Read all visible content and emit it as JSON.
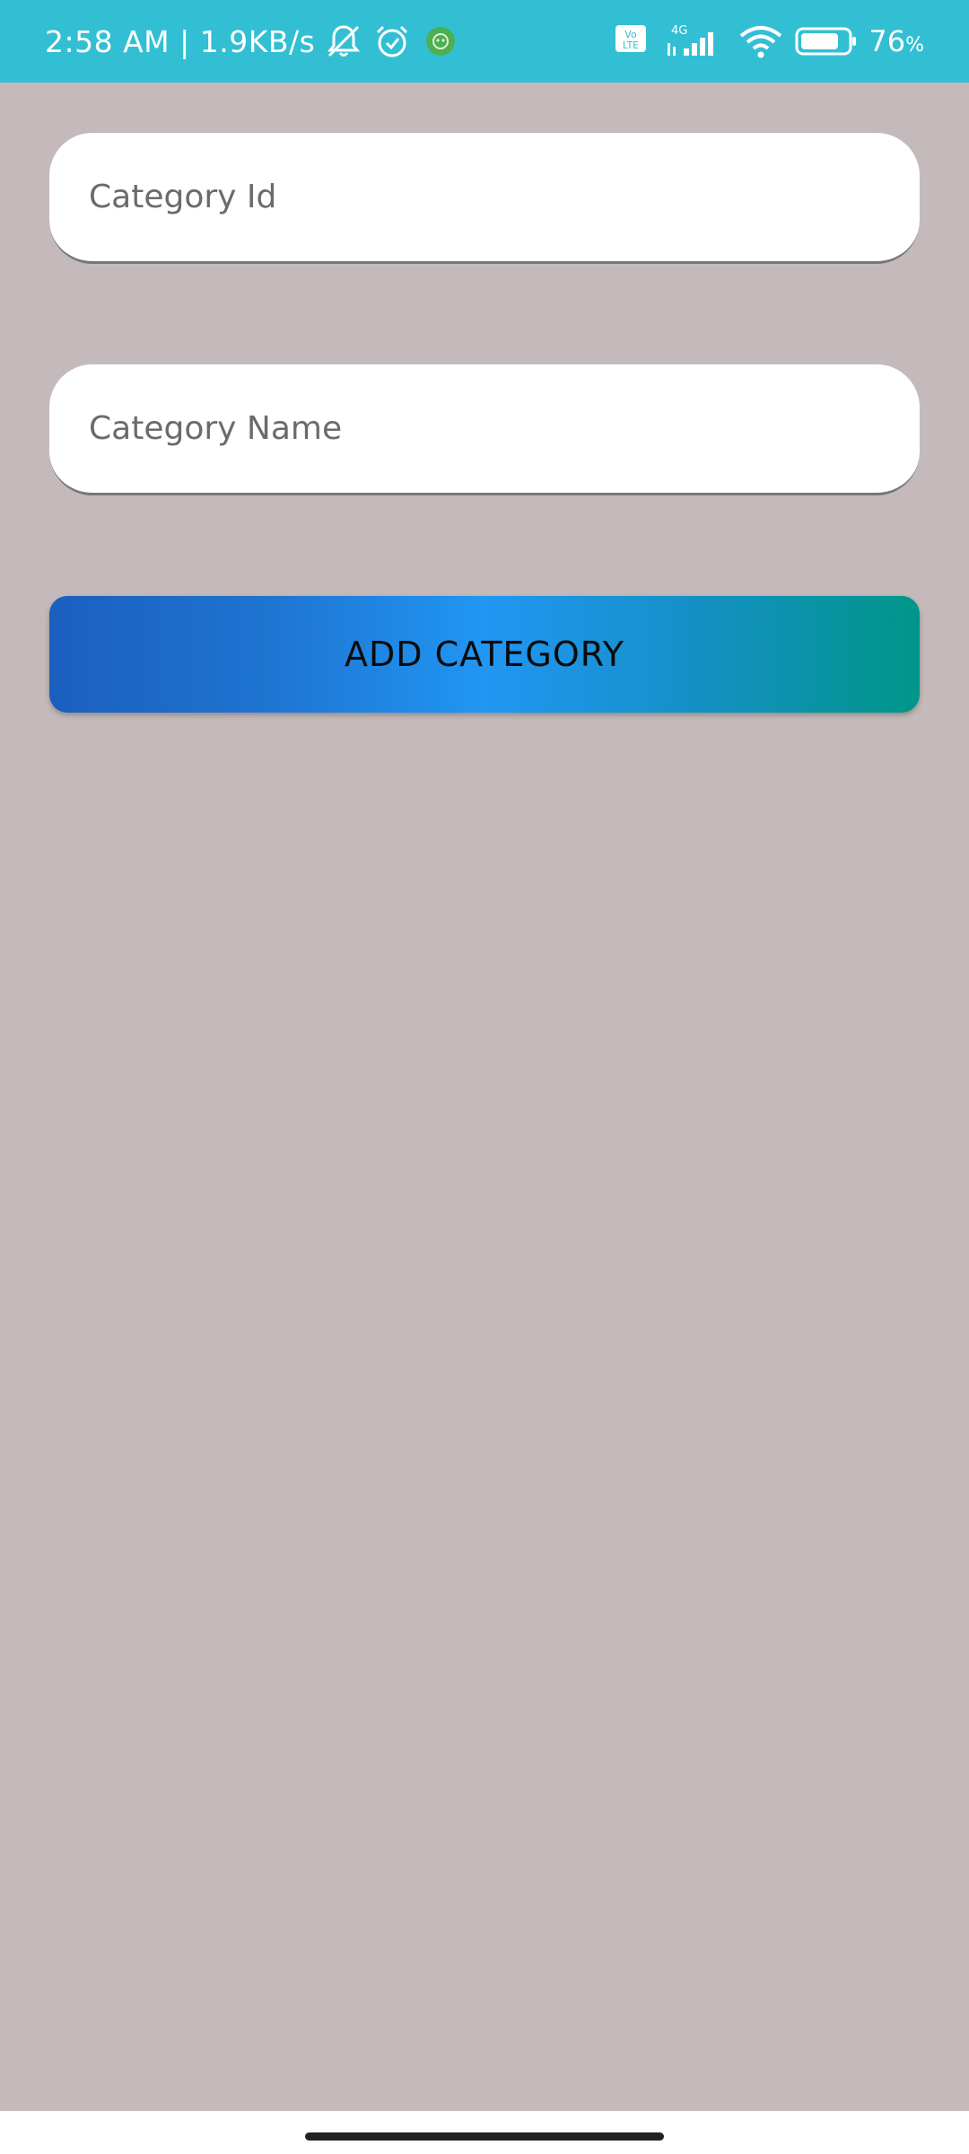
{
  "status_bar": {
    "time": "2:58 AM | 1.9KB/s",
    "battery": "76",
    "battery_unit": "%",
    "network": "4G",
    "volte": "Vo LTE",
    "icons": [
      "mute-bell-icon",
      "alarm-icon",
      "app-notification-icon",
      "volte-icon",
      "signal-icon",
      "wifi-icon",
      "battery-icon"
    ]
  },
  "form": {
    "category_id": {
      "placeholder": "Category Id",
      "value": ""
    },
    "category_name": {
      "placeholder": "Category Name",
      "value": ""
    },
    "add_button_label": "ADD CATEGORY"
  },
  "colors": {
    "status_bar": "#33bfd3",
    "background": "#c5babb",
    "button_gradient_start": "#1b5fbf",
    "button_gradient_mid": "#2196f3",
    "button_gradient_end": "#009688"
  }
}
